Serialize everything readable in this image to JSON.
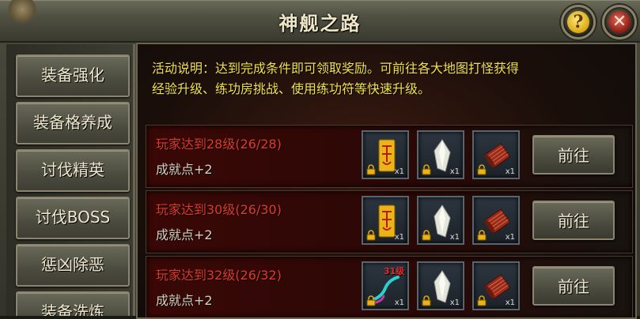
{
  "window": {
    "title": "神舰之路"
  },
  "sidebar": {
    "items": [
      {
        "label": "装备强化"
      },
      {
        "label": "装备格养成"
      },
      {
        "label": "讨伐精英"
      },
      {
        "label": "讨伐BOSS"
      },
      {
        "label": "惩凶除恶"
      },
      {
        "label": "装备洗炼"
      }
    ]
  },
  "content": {
    "description_line1": "活动说明：达到完成条件即可领取奖励。可前往各大地图打怪获得",
    "description_line2": "经验升级、练功房挑战、使用练功符等快速升级。",
    "rows": [
      {
        "title": "玩家达到28级(26/28)",
        "reward": "成就点+2",
        "items": [
          {
            "icon": "yellow-talisman-icon",
            "qty": "x1"
          },
          {
            "icon": "crystal-shard-icon",
            "qty": "x1"
          },
          {
            "icon": "red-scroll-icon",
            "qty": "x1"
          }
        ],
        "button": "前往"
      },
      {
        "title": "玩家达到30级(26/30)",
        "reward": "成就点+2",
        "items": [
          {
            "icon": "yellow-talisman-icon",
            "qty": "x1"
          },
          {
            "icon": "crystal-shard-icon",
            "qty": "x1"
          },
          {
            "icon": "red-scroll-icon",
            "qty": "x1"
          }
        ],
        "button": "前往"
      },
      {
        "title": "玩家达到32级(26/32)",
        "reward": "成就点+2",
        "items": [
          {
            "icon": "cyan-whip-icon",
            "qty": "x1",
            "level": "31级"
          },
          {
            "icon": "crystal-shard-icon",
            "qty": "x1"
          },
          {
            "icon": "red-scroll-icon",
            "qty": "x1"
          }
        ],
        "button": "前往"
      }
    ]
  },
  "colors": {
    "description": "#f4e14a",
    "row_title": "#e23a2a",
    "level_tag": "#e02c2c"
  }
}
